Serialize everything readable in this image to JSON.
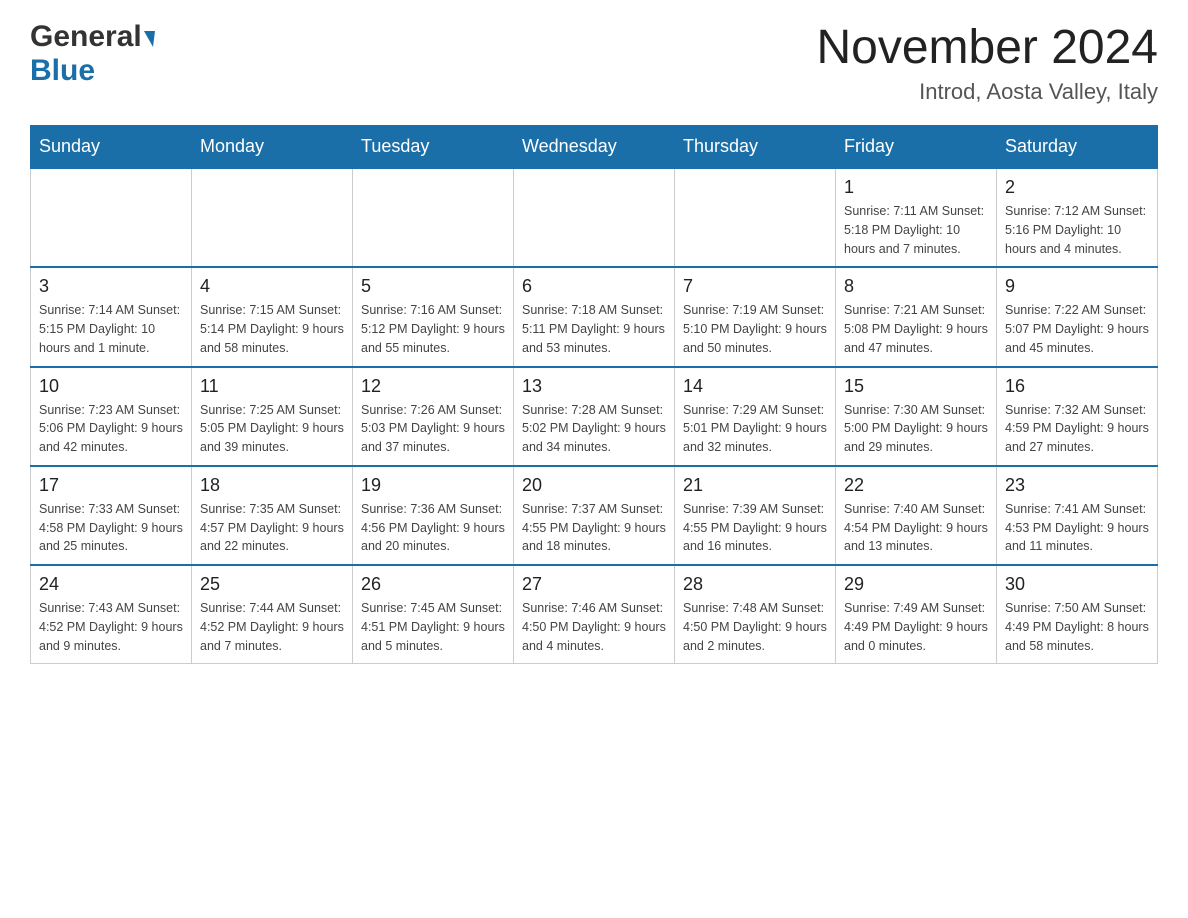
{
  "header": {
    "logo_line1": "General",
    "logo_line2": "Blue",
    "main_title": "November 2024",
    "subtitle": "Introd, Aosta Valley, Italy"
  },
  "weekdays": [
    "Sunday",
    "Monday",
    "Tuesday",
    "Wednesday",
    "Thursday",
    "Friday",
    "Saturday"
  ],
  "weeks": [
    {
      "days": [
        {
          "number": "",
          "info": "",
          "empty": true
        },
        {
          "number": "",
          "info": "",
          "empty": true
        },
        {
          "number": "",
          "info": "",
          "empty": true
        },
        {
          "number": "",
          "info": "",
          "empty": true
        },
        {
          "number": "",
          "info": "",
          "empty": true
        },
        {
          "number": "1",
          "info": "Sunrise: 7:11 AM\nSunset: 5:18 PM\nDaylight: 10 hours\nand 7 minutes."
        },
        {
          "number": "2",
          "info": "Sunrise: 7:12 AM\nSunset: 5:16 PM\nDaylight: 10 hours\nand 4 minutes."
        }
      ]
    },
    {
      "days": [
        {
          "number": "3",
          "info": "Sunrise: 7:14 AM\nSunset: 5:15 PM\nDaylight: 10 hours\nand 1 minute."
        },
        {
          "number": "4",
          "info": "Sunrise: 7:15 AM\nSunset: 5:14 PM\nDaylight: 9 hours\nand 58 minutes."
        },
        {
          "number": "5",
          "info": "Sunrise: 7:16 AM\nSunset: 5:12 PM\nDaylight: 9 hours\nand 55 minutes."
        },
        {
          "number": "6",
          "info": "Sunrise: 7:18 AM\nSunset: 5:11 PM\nDaylight: 9 hours\nand 53 minutes."
        },
        {
          "number": "7",
          "info": "Sunrise: 7:19 AM\nSunset: 5:10 PM\nDaylight: 9 hours\nand 50 minutes."
        },
        {
          "number": "8",
          "info": "Sunrise: 7:21 AM\nSunset: 5:08 PM\nDaylight: 9 hours\nand 47 minutes."
        },
        {
          "number": "9",
          "info": "Sunrise: 7:22 AM\nSunset: 5:07 PM\nDaylight: 9 hours\nand 45 minutes."
        }
      ]
    },
    {
      "days": [
        {
          "number": "10",
          "info": "Sunrise: 7:23 AM\nSunset: 5:06 PM\nDaylight: 9 hours\nand 42 minutes."
        },
        {
          "number": "11",
          "info": "Sunrise: 7:25 AM\nSunset: 5:05 PM\nDaylight: 9 hours\nand 39 minutes."
        },
        {
          "number": "12",
          "info": "Sunrise: 7:26 AM\nSunset: 5:03 PM\nDaylight: 9 hours\nand 37 minutes."
        },
        {
          "number": "13",
          "info": "Sunrise: 7:28 AM\nSunset: 5:02 PM\nDaylight: 9 hours\nand 34 minutes."
        },
        {
          "number": "14",
          "info": "Sunrise: 7:29 AM\nSunset: 5:01 PM\nDaylight: 9 hours\nand 32 minutes."
        },
        {
          "number": "15",
          "info": "Sunrise: 7:30 AM\nSunset: 5:00 PM\nDaylight: 9 hours\nand 29 minutes."
        },
        {
          "number": "16",
          "info": "Sunrise: 7:32 AM\nSunset: 4:59 PM\nDaylight: 9 hours\nand 27 minutes."
        }
      ]
    },
    {
      "days": [
        {
          "number": "17",
          "info": "Sunrise: 7:33 AM\nSunset: 4:58 PM\nDaylight: 9 hours\nand 25 minutes."
        },
        {
          "number": "18",
          "info": "Sunrise: 7:35 AM\nSunset: 4:57 PM\nDaylight: 9 hours\nand 22 minutes."
        },
        {
          "number": "19",
          "info": "Sunrise: 7:36 AM\nSunset: 4:56 PM\nDaylight: 9 hours\nand 20 minutes."
        },
        {
          "number": "20",
          "info": "Sunrise: 7:37 AM\nSunset: 4:55 PM\nDaylight: 9 hours\nand 18 minutes."
        },
        {
          "number": "21",
          "info": "Sunrise: 7:39 AM\nSunset: 4:55 PM\nDaylight: 9 hours\nand 16 minutes."
        },
        {
          "number": "22",
          "info": "Sunrise: 7:40 AM\nSunset: 4:54 PM\nDaylight: 9 hours\nand 13 minutes."
        },
        {
          "number": "23",
          "info": "Sunrise: 7:41 AM\nSunset: 4:53 PM\nDaylight: 9 hours\nand 11 minutes."
        }
      ]
    },
    {
      "days": [
        {
          "number": "24",
          "info": "Sunrise: 7:43 AM\nSunset: 4:52 PM\nDaylight: 9 hours\nand 9 minutes."
        },
        {
          "number": "25",
          "info": "Sunrise: 7:44 AM\nSunset: 4:52 PM\nDaylight: 9 hours\nand 7 minutes."
        },
        {
          "number": "26",
          "info": "Sunrise: 7:45 AM\nSunset: 4:51 PM\nDaylight: 9 hours\nand 5 minutes."
        },
        {
          "number": "27",
          "info": "Sunrise: 7:46 AM\nSunset: 4:50 PM\nDaylight: 9 hours\nand 4 minutes."
        },
        {
          "number": "28",
          "info": "Sunrise: 7:48 AM\nSunset: 4:50 PM\nDaylight: 9 hours\nand 2 minutes."
        },
        {
          "number": "29",
          "info": "Sunrise: 7:49 AM\nSunset: 4:49 PM\nDaylight: 9 hours\nand 0 minutes."
        },
        {
          "number": "30",
          "info": "Sunrise: 7:50 AM\nSunset: 4:49 PM\nDaylight: 8 hours\nand 58 minutes."
        }
      ]
    }
  ]
}
